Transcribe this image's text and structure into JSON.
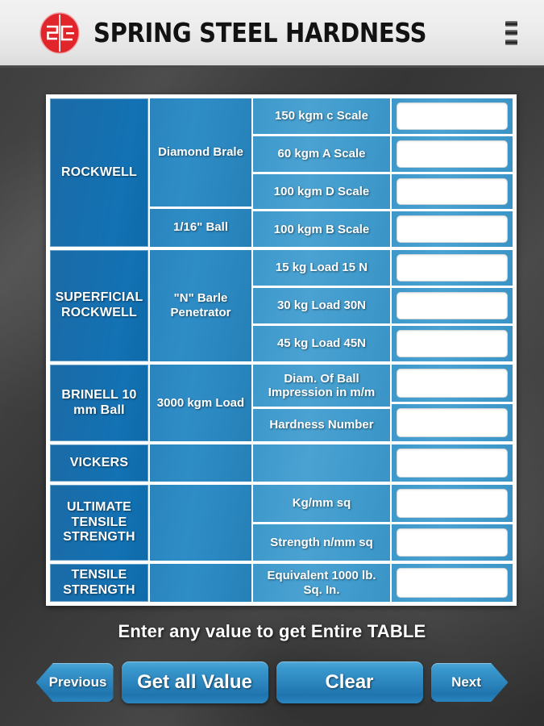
{
  "header": {
    "title": "SPRING STEEL HARDNESS",
    "logo_text": "SC",
    "logo_color": "#e0262b",
    "menu_icon": "hamburger-menu-icon"
  },
  "theme": {
    "col1_blue": "#1272b4",
    "col2_blue": "#2f8dc6",
    "col3_blue": "#4aa2d2",
    "button_blue": "#2c85bd",
    "background": "#3e3e3e"
  },
  "table": {
    "groups": [
      {
        "name": "ROCKWELL",
        "sub": [
          {
            "label": "Diamond Brale",
            "rows": [
              "150 kgm c Scale",
              "60 kgm A Scale",
              "100 kgm D Scale"
            ]
          },
          {
            "label": "1/16\" Ball",
            "rows": [
              "100 kgm B Scale"
            ]
          }
        ],
        "values": [
          "",
          "",
          "",
          ""
        ],
        "placeholders": [
          "",
          "",
          "",
          ""
        ]
      },
      {
        "name": "SUPERFICIAL ROCKWELL",
        "sub": [
          {
            "label": "\"N\" Barle Penetrator",
            "rows": [
              "15 kg Load 15 N",
              "30 kg Load 30N",
              "45 kg Load 45N"
            ]
          }
        ],
        "values": [
          "",
          "",
          ""
        ],
        "placeholders": [
          "",
          "",
          ""
        ]
      },
      {
        "name": "BRINELL 10 mm Ball",
        "sub": [
          {
            "label": "3000 kgm Load",
            "rows": [
              "Diam. Of Ball Impression in m/m",
              "Hardness Number"
            ]
          }
        ],
        "values": [
          "",
          ""
        ],
        "placeholders": [
          "",
          ""
        ]
      },
      {
        "name": "VICKERS",
        "sub": [
          {
            "label": "",
            "rows": [
              ""
            ]
          }
        ],
        "values": [
          ""
        ],
        "placeholders": [
          ""
        ]
      },
      {
        "name": "ULTIMATE TENSILE STRENGTH",
        "sub": [
          {
            "label": "",
            "rows": [
              "Kg/mm sq",
              "Strength n/mm sq"
            ]
          }
        ],
        "values": [
          "",
          ""
        ],
        "placeholders": [
          "",
          ""
        ]
      },
      {
        "name": "TENSILE STRENGTH",
        "sub": [
          {
            "label": "",
            "rows": [
              "Equivalent 1000 lb. Sq. In."
            ]
          }
        ],
        "values": [
          ""
        ],
        "placeholders": [
          ""
        ]
      }
    ]
  },
  "footer": {
    "hint": "Enter any value to get Entire TABLE",
    "buttons": {
      "previous": "Previous",
      "get_all": "Get all Value",
      "clear": "Clear",
      "next": "Next"
    }
  }
}
